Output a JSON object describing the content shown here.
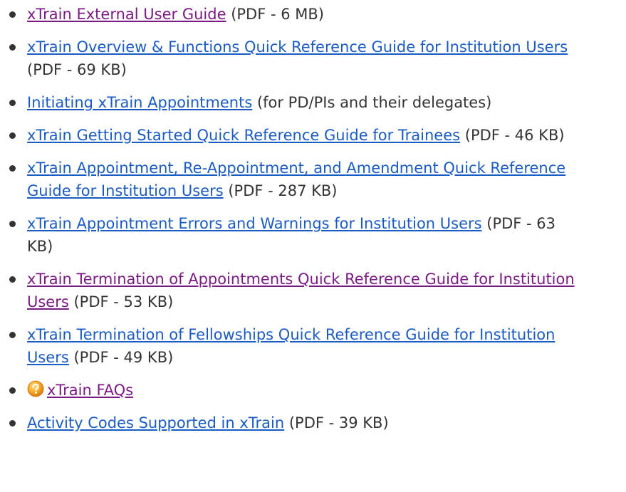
{
  "items": [
    {
      "link": "xTrain External User Guide",
      "suffix": " (PDF - 6 MB)",
      "visited": true
    },
    {
      "link": "xTrain Overview & Functions Quick Reference Guide for Institution Users",
      "suffix": " (PDF - 69 KB)",
      "visited": false
    },
    {
      "link": "Initiating xTrain Appointments",
      "suffix": " (for PD/PIs and their delegates)",
      "visited": false
    },
    {
      "link": "xTrain Getting Started Quick Reference Guide for Trainees",
      "suffix": " (PDF - 46 KB)",
      "visited": false
    },
    {
      "link": "xTrain Appointment, Re-Appointment, and Amendment Quick Reference Guide for Institution Users",
      "suffix": " (PDF - 287 KB)",
      "visited": false
    },
    {
      "link": "xTrain Appointment Errors and Warnings for Institution Users",
      "suffix": " (PDF - 63 KB)",
      "visited": false
    },
    {
      "link": "xTrain Termination of Appointments Quick Reference Guide for Institution Users",
      "suffix": " (PDF - 53 KB)",
      "visited": true
    },
    {
      "link": "xTrain Termination of Fellowships Quick Reference Guide for Institution Users",
      "suffix": " (PDF - 49 KB)",
      "visited": false
    },
    {
      "link": "xTrain FAQs",
      "suffix": "",
      "visited": true,
      "icon": "help-question-icon"
    },
    {
      "link": "Activity Codes Supported in xTrain",
      "suffix": " (PDF - 39 KB)",
      "visited": false
    }
  ],
  "colors": {
    "link": "#1a5bc4",
    "visited": "#7b1a85",
    "text": "#333333",
    "icon": "#f0a020"
  }
}
